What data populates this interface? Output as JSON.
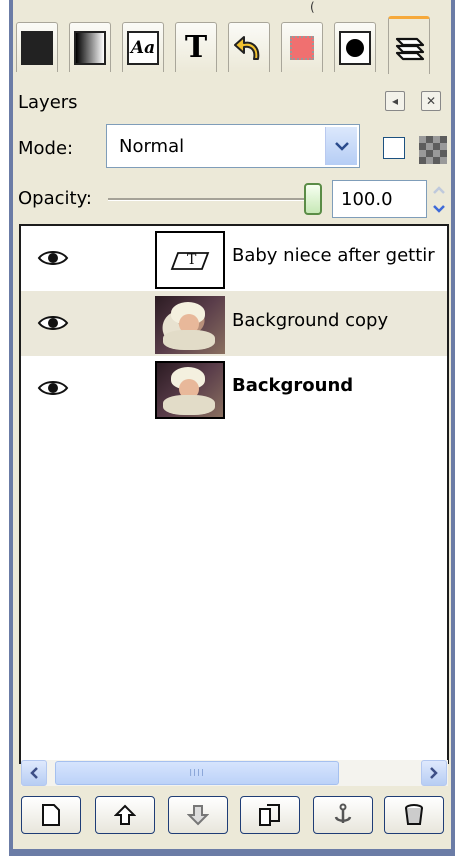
{
  "top_peek": "(",
  "tabs": [
    {
      "icon": "palette-grid-icon"
    },
    {
      "icon": "gradient-icon"
    },
    {
      "icon": "fonts-icon",
      "glyph": "Aa"
    },
    {
      "icon": "text-tool-icon",
      "glyph": "T"
    },
    {
      "icon": "undo-history-icon"
    },
    {
      "icon": "channels-icon"
    },
    {
      "icon": "paths-icon"
    },
    {
      "icon": "layers-icon"
    }
  ],
  "panel": {
    "title": "Layers",
    "mode_label": "Mode:",
    "mode_value": "Normal",
    "opacity_label": "Opacity:",
    "opacity_value": "100.0",
    "opacity_level": 1.0
  },
  "layers": [
    {
      "name": "Baby niece after gettir",
      "type": "text",
      "visible": true,
      "selected": false,
      "bold": false
    },
    {
      "name": "Background copy",
      "type": "image",
      "visible": true,
      "selected": true,
      "bold": false
    },
    {
      "name": "Background",
      "type": "image",
      "visible": true,
      "selected": false,
      "bold": true
    }
  ],
  "scrollbar": {
    "grip": "IIII"
  },
  "bottom_buttons": [
    {
      "icon": "new-layer-icon"
    },
    {
      "icon": "raise-layer-icon"
    },
    {
      "icon": "lower-layer-icon"
    },
    {
      "icon": "duplicate-layer-icon"
    },
    {
      "icon": "anchor-layer-icon"
    },
    {
      "icon": "delete-layer-icon"
    }
  ],
  "colors": {
    "accent": "#f6a93b",
    "selection": "#ebe8da",
    "panel_bg": "#ece9d8",
    "border_blue": "#7f9db9"
  }
}
